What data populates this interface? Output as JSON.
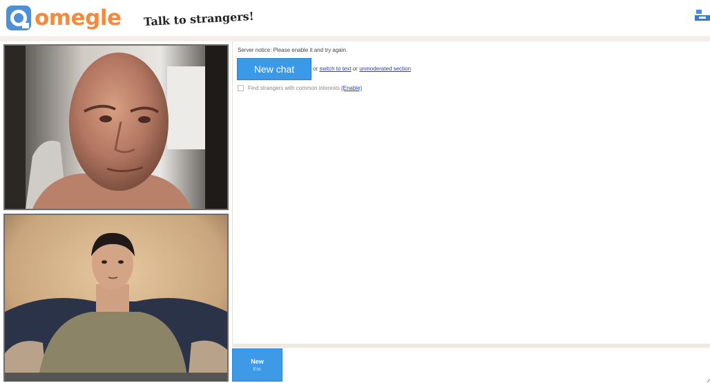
{
  "header": {
    "logo_text": "omegle",
    "tagline": "Talk to strangers!",
    "brand_color": "#f7893b",
    "logo_icon": "omegle-logo-icon",
    "widget_icon": "blue-widget-icon"
  },
  "videos": {
    "stranger": "stranger-video",
    "self": "self-video"
  },
  "log": {
    "status_text": "Server notice: Please enable it and try again.",
    "new_chat_label": "New chat",
    "or_text": "or",
    "switch_text_link": "switch to text",
    "or_text_2": "or",
    "unmoderated_link": "unmoderated section",
    "interests_text": "Find strangers with common interests",
    "interests_link": "(Enable)"
  },
  "controls": {
    "new_label": "New",
    "new_hint": "Esc",
    "message_placeholder": "",
    "accent_color": "#3e9ae6"
  }
}
